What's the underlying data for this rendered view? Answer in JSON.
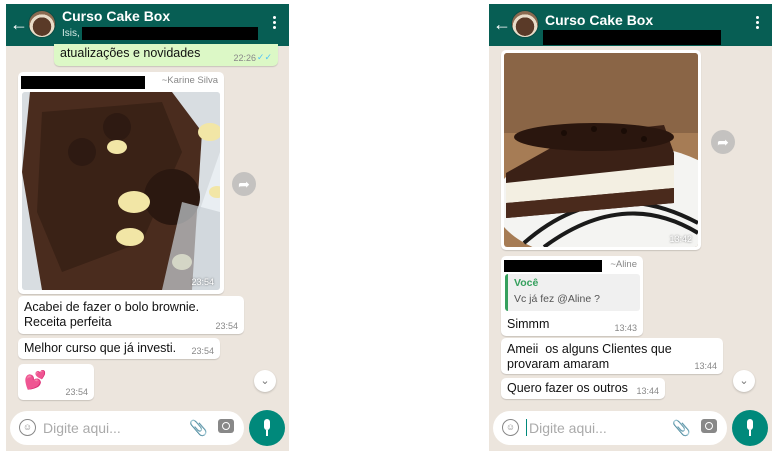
{
  "left": {
    "header": {
      "title": "Curso Cake Box",
      "subtitle": "Isis,"
    },
    "messages": {
      "preview_text": "atualizações e novidades",
      "preview_time": "22:26",
      "photo_sender": "~Karine Silva",
      "photo_time": "23:54",
      "msg1_text": "Acabei de fazer o bolo brownie.\nReceita perfeita",
      "msg1_time": "23:54",
      "msg2_text": "Melhor curso que já investi.",
      "msg2_time": "23:54",
      "msg3_emoji": "💕",
      "msg3_time": "23:54"
    },
    "input": {
      "placeholder": "Digite aqui..."
    }
  },
  "right": {
    "header": {
      "title": "Curso Cake Box"
    },
    "messages": {
      "photo_time": "13:42",
      "reply_sender": "~Aline",
      "quote_name": "Você",
      "quote_text": "Vc já fez @Aline ?",
      "reply_text": "Simmm",
      "reply_time": "13:43",
      "msg2_text": "Ameii  os alguns Clientes que\nprovaram amaram",
      "msg2_time": "13:44",
      "msg3_text": "Quero fazer os outros",
      "msg3_time": "13:44"
    },
    "input": {
      "placeholder": "Digite aqui..."
    }
  },
  "icons": {
    "back": "arrow-left",
    "menu": "vertical-dots",
    "forward": "forward-arrow",
    "scroll": "chevron-down",
    "emoji": "smiley",
    "attach": "paperclip",
    "camera": "camera",
    "mic": "microphone"
  },
  "colors": {
    "header": "#075e54",
    "chat_bg": "#ece5dd",
    "outgoing": "#dcf8c6",
    "mic_button": "#00897b",
    "quote_accent": "#35a05d"
  }
}
